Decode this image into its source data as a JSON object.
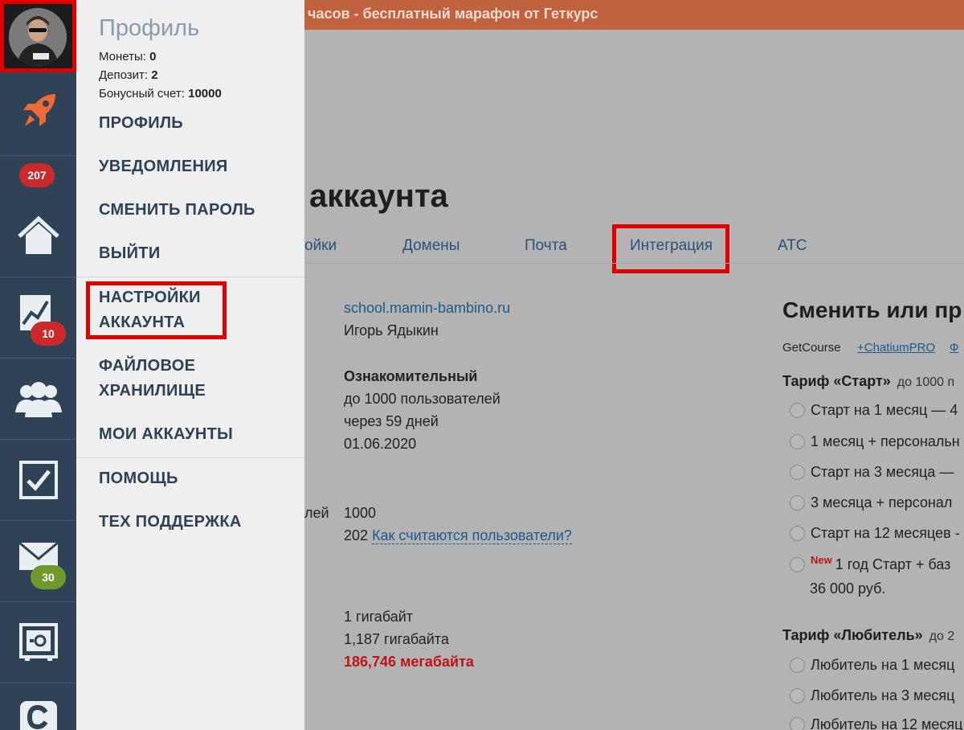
{
  "sidebar": {
    "badges": {
      "rocket_badge": "207",
      "chart_badge": "10",
      "mail_badge": "30"
    }
  },
  "profile_panel": {
    "title": "Профиль",
    "coins_label": "Монеты:",
    "coins_value": "0",
    "deposit_label": "Депозит:",
    "deposit_value": "2",
    "bonus_label": "Бонусный счет:",
    "bonus_value": "10000",
    "menu": {
      "profile": "ПРОФИЛЬ",
      "notifications": "УВЕДОМЛЕНИЯ",
      "change_password": "СМЕНИТЬ ПАРОЛЬ",
      "logout": "ВЫЙТИ",
      "account_settings_1": "НАСТРОЙКИ",
      "account_settings_2": "АККАУНТА",
      "file_storage_1": "ФАЙЛОВОЕ",
      "file_storage_2": "ХРАНИЛИЩЕ",
      "my_accounts": "МОИ АККАУНТЫ",
      "help": "ПОМОЩЬ",
      "tech_support": "ТЕХ ПОДДЕРЖКА"
    }
  },
  "banner": {
    "text": "часов - бесплатный марафон от Геткурс"
  },
  "main": {
    "title": "аккаунта",
    "tabs": {
      "settings": "ойки",
      "domains": "Домены",
      "mail": "Почта",
      "integration": "Интеграция",
      "ats": "АТС"
    },
    "account": {
      "domain": "school.mamin-bambino.ru",
      "owner": "Игорь Ядыкин",
      "plan": "Ознакомительный",
      "plan_users": "до 1000 пользователей",
      "plan_days": "через 59 дней",
      "plan_date": "01.06.2020",
      "users_label_fragment": "лей",
      "users_limit": "1000",
      "users_count": "202",
      "users_link": "Как считаются пользователи?",
      "storage_limit": "1 гигабайт",
      "storage_used": "1,187 гигабайта",
      "storage_over": "186,746 мегабайта"
    },
    "right": {
      "title": "Сменить или пр",
      "provider_getcourse": "GetCourse",
      "provider_chatium": "+ChatiumPRO",
      "provider_more": "Ф",
      "tariff_start_title": "Тариф «Старт»",
      "tariff_start_note": "до 1000 п",
      "start_options": [
        "Старт на 1 месяц — 4",
        "1 месяц + персональн",
        "Старт на 3 месяца —",
        "3 месяца + персонал",
        "Старт на 12 месяцев -"
      ],
      "new_label": "New",
      "start_year_option": "1 год Старт + баз",
      "start_year_price": "36 000 руб.",
      "tariff_amateur_title": "Тариф «Любитель»",
      "tariff_amateur_note": "до 2",
      "amateur_options": [
        "Любитель на 1 месяц",
        "Любитель на 3 месяц",
        "Любитель на 12 месяц"
      ]
    }
  },
  "colors": {
    "sidebar": "#2f4256",
    "banner": "#c1623e",
    "highlight": "#e00000",
    "overlay": "#b3b3b3",
    "panel": "#efefef"
  }
}
